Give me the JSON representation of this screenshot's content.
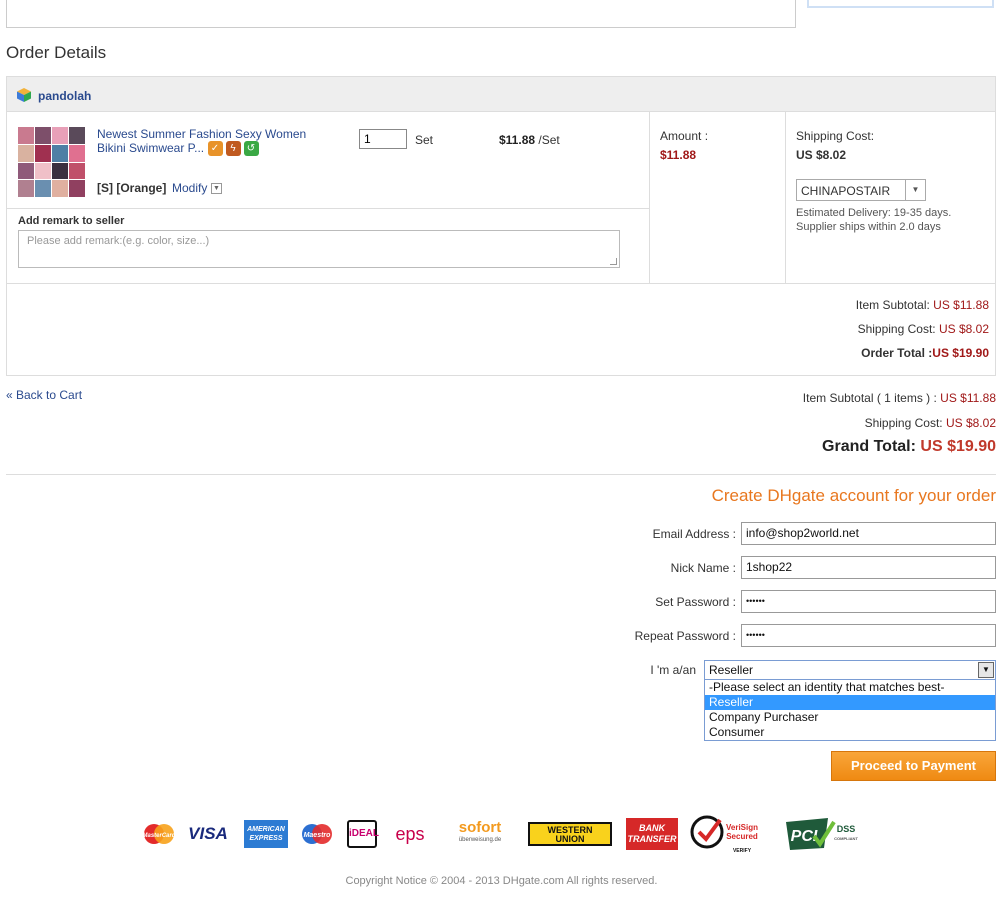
{
  "section_title": "Order Details",
  "seller": {
    "name": "pandolah"
  },
  "product": {
    "title": "Newest Summer Fashion Sexy Women Bikini Swimwear P...",
    "variant": "[S] [Orange]",
    "modify_label": "Modify",
    "quantity": "1",
    "unit": "Set",
    "price": "$11.88",
    "price_unit": "/Set",
    "badges": [
      "guarantee-icon",
      "express-icon",
      "return-icon"
    ]
  },
  "remark": {
    "label": "Add remark to seller",
    "placeholder": "Please add remark:(e.g. color, size...)"
  },
  "amount": {
    "label": "Amount :",
    "value": "$11.88"
  },
  "shipping": {
    "label": "Shipping Cost:",
    "value": "US $8.02",
    "carrier": "CHINAPOSTAIR",
    "estimated": "Estimated Delivery: 19-35 days.",
    "ships_within": "Supplier ships within 2.0 days"
  },
  "store_summary": {
    "item_subtotal_label": "Item Subtotal:",
    "item_subtotal_value": "US $11.88",
    "shipping_label": "Shipping Cost:",
    "shipping_value": "US $8.02",
    "order_total_label": "Order Total :",
    "order_total_value": "US $19.90"
  },
  "back_to_cart": "« Back to Cart",
  "totals": {
    "item_subtotal_label": "Item Subtotal ( 1 items ) :",
    "item_subtotal_value": "US $11.88",
    "shipping_label": "Shipping Cost:",
    "shipping_value": "US $8.02",
    "grand_label": "Grand Total:",
    "grand_value": "US $19.90"
  },
  "account": {
    "title": "Create DHgate account for your order",
    "email_label": "Email Address :",
    "email_value": "info@shop2world.net",
    "nick_label": "Nick Name :",
    "nick_value": "1shop22",
    "password_label": "Set Password :",
    "password_value": "••••••",
    "repeat_label": "Repeat Password :",
    "repeat_value": "••••••",
    "identity_label": "I 'm a/an",
    "identity_selected": "Reseller",
    "identity_options": [
      "-Please select an identity that matches best-",
      "Reseller",
      "Company Purchaser",
      "Consumer"
    ],
    "proceed_label": "Proceed to Payment"
  },
  "payment_logos": {
    "mastercard": "MasterCard",
    "visa": "VISA",
    "amex_line1": "AMERICAN",
    "amex_line2": "EXPRESS",
    "maestro": "Maestro",
    "ideal": "iDEAL",
    "eps": "eps",
    "sofort": "sofort",
    "sofort_sub": "überweisung.de",
    "western_union_line1": "WESTERN",
    "western_union_line2": "UNION",
    "bank_line1": "BANK",
    "bank_line2": "TRANSFER",
    "verisign_line1": "VeriSign",
    "verisign_line2": "Secured",
    "verisign_sub": "VERIFY",
    "pci": "PCI",
    "dss": "DSS",
    "dss_sub": "COMPLIANT"
  },
  "colors": {
    "accent_orange": "#e8771f",
    "price_red": "#a01818",
    "link_blue": "#2a4a8e",
    "select_blue": "#3399ff"
  },
  "copyright": "Copyright Notice © 2004 - 2013 DHgate.com All rights reserved."
}
